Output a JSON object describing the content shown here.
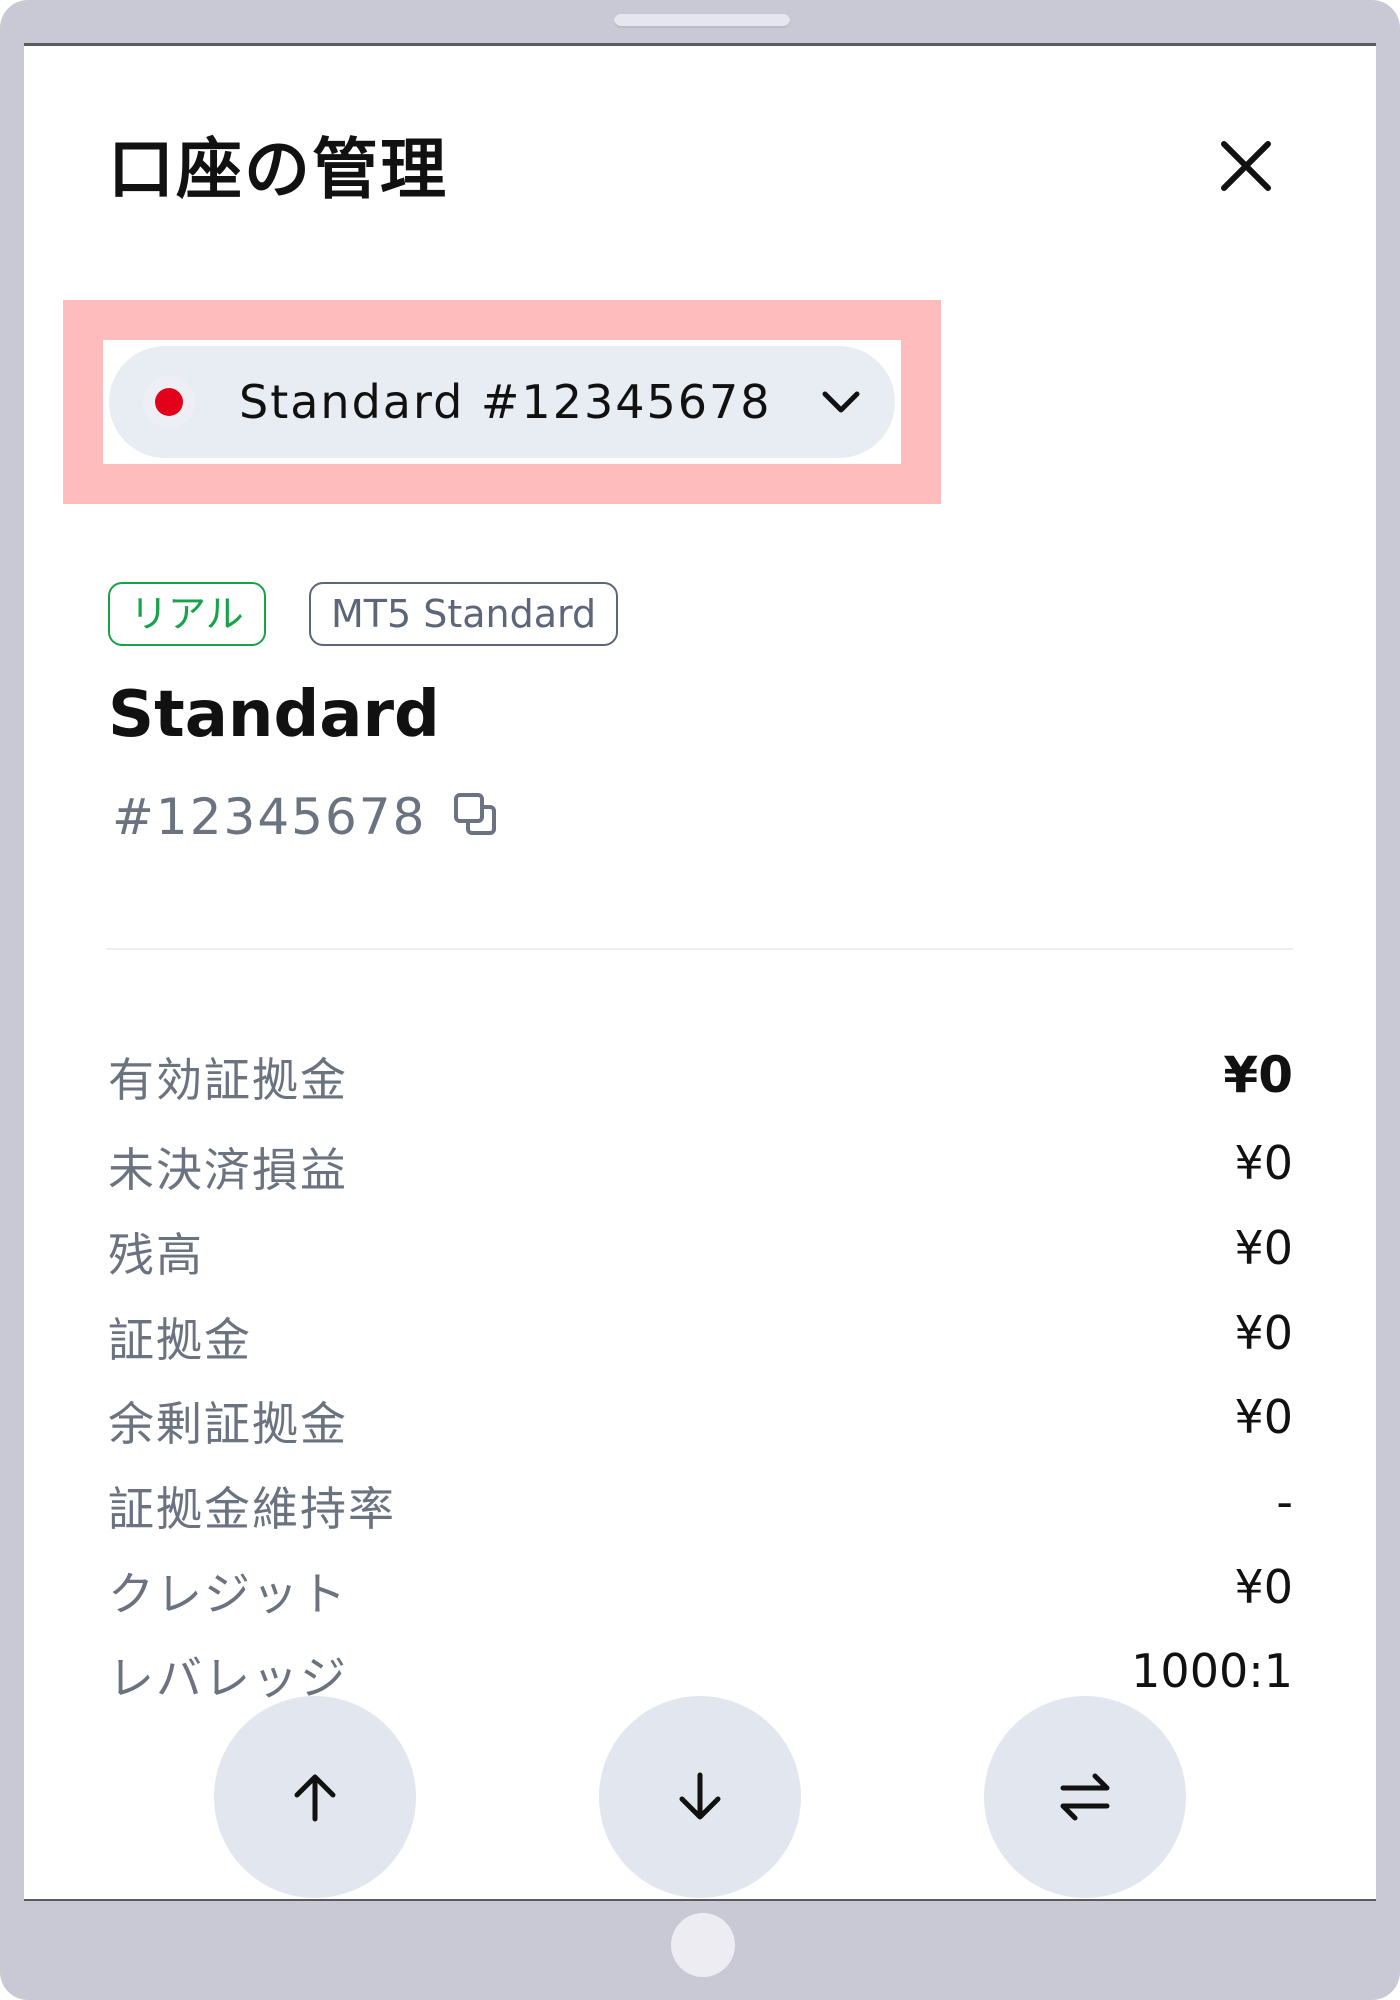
{
  "header": {
    "title": "口座の管理",
    "close_icon": "close-icon"
  },
  "account_selector": {
    "flag_icon": "japan-flag-icon",
    "label": "Standard #12345678",
    "chevron_icon": "chevron-down-icon"
  },
  "tags": {
    "real": "リアル",
    "type": "MT5 Standard"
  },
  "account": {
    "name": "Standard",
    "number": "#12345678",
    "copy_icon": "copy-icon"
  },
  "stats": [
    {
      "label": "有効証拠金",
      "value": "¥0"
    },
    {
      "label": "未決済損益",
      "value": "¥0"
    },
    {
      "label": "残高",
      "value": "¥0"
    },
    {
      "label": "証拠金",
      "value": "¥0"
    },
    {
      "label": "余剰証拠金",
      "value": "¥0"
    },
    {
      "label": "証拠金維持率",
      "value": "-"
    },
    {
      "label": "クレジット",
      "value": "¥0"
    },
    {
      "label": "レバレッジ",
      "value": "1000:1"
    }
  ],
  "actions": [
    {
      "icon": "arrow-up-icon"
    },
    {
      "icon": "arrow-down-icon"
    },
    {
      "icon": "transfer-arrows-icon"
    }
  ],
  "colors": {
    "highlight": "#ffbcbd",
    "real_tag": "#16a34a",
    "flag_red": "#e3001b",
    "pill_bg": "#e8ecf3"
  }
}
